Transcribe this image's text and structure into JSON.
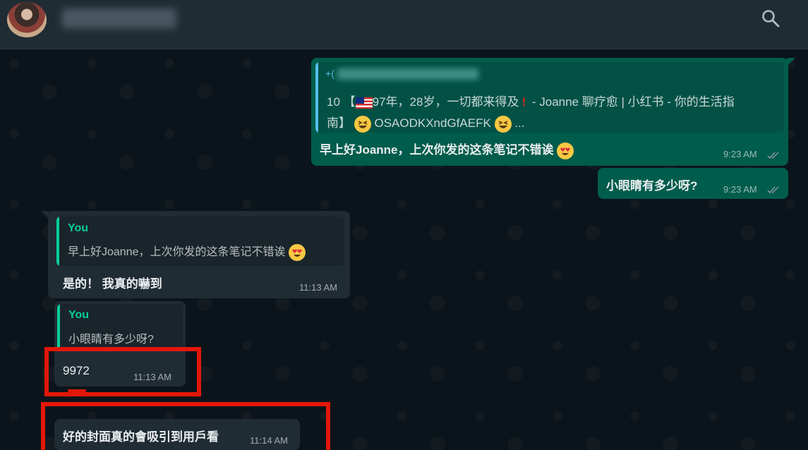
{
  "header": {
    "contact_name": "·",
    "search_icon": "search-icon"
  },
  "messages": {
    "link_preview": {
      "sender_phone": "+(",
      "line1": "10 【",
      "line1b": "97年，28岁，一切都来得及",
      "line1c": " - Joanne 聊疗愈 | 小红书 - 你的生活指",
      "line2a": "南】",
      "line2b": "OSAODKXndGfAEFK",
      "line2c": "...",
      "flag_icon": "malaysia-flag-icon",
      "exclamation_icon": "exclamation-icon",
      "emoji_icon": "grinning-squinting-face-icon"
    },
    "out1": {
      "text": "早上好Joanne，上次你发的这条笔记不错诶",
      "emoji": "heart-eyes-icon",
      "time": "9:23 AM"
    },
    "out2": {
      "text": "小眼睛有多少呀?",
      "time": "9:23 AM"
    },
    "in1": {
      "quote_name": "You",
      "quote_text": "早上好Joanne，上次你发的这条笔记不错诶",
      "quote_emoji": "heart-eyes-icon",
      "text": "是的！ 我真的嚇到",
      "time": "11:13 AM"
    },
    "in2": {
      "quote_name": "You",
      "quote_text": "小眼睛有多少呀?",
      "text": "9972",
      "time": "11:13 AM"
    },
    "in3": {
      "text": "好的封面真的會吸引到用戶看",
      "time": "11:14 AM"
    }
  },
  "colors": {
    "outgoing_bubble": "#005c4b",
    "incoming_bubble": "#202c33",
    "quote_accent": "#06cf9c",
    "highlight_box": "#e3170a"
  }
}
